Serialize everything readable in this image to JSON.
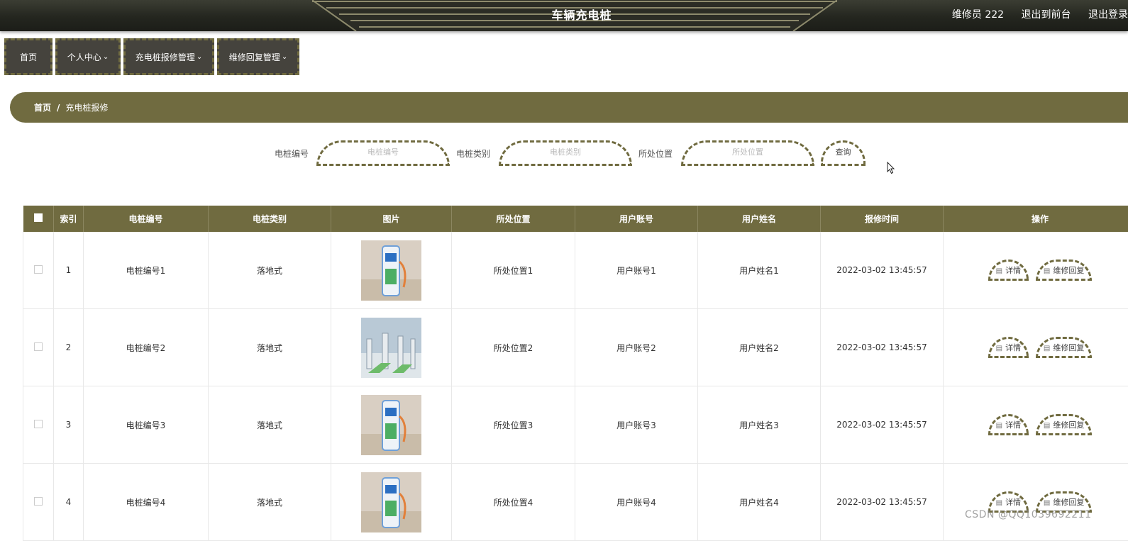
{
  "header": {
    "title": "车辆充电桩",
    "user_label": "维修员 222",
    "to_front_label": "退出到前台",
    "logout_label": "退出登录"
  },
  "nav": {
    "items": [
      {
        "label": "首页"
      },
      {
        "label": "个人中心"
      },
      {
        "label": "充电桩报修管理"
      },
      {
        "label": "维修回复管理"
      }
    ]
  },
  "breadcrumb": {
    "home": "首页",
    "separator": "/",
    "current": "充电桩报修"
  },
  "search": {
    "fields": [
      {
        "label": "电桩编号",
        "placeholder": "电桩编号"
      },
      {
        "label": "电桩类别",
        "placeholder": "电桩类别"
      },
      {
        "label": "所处位置",
        "placeholder": "所处位置"
      }
    ],
    "button_label": "查询"
  },
  "table": {
    "columns": [
      "索引",
      "电桩编号",
      "电桩类别",
      "图片",
      "所处位置",
      "用户账号",
      "用户姓名",
      "报修时间",
      "操作"
    ],
    "rows": [
      {
        "index": "1",
        "code": "电桩编号1",
        "category": "落地式",
        "location": "所处位置1",
        "account": "用户账号1",
        "name": "用户姓名1",
        "time": "2022-03-02 13:45:57"
      },
      {
        "index": "2",
        "code": "电桩编号2",
        "category": "落地式",
        "location": "所处位置2",
        "account": "用户账号2",
        "name": "用户姓名2",
        "time": "2022-03-02 13:45:57"
      },
      {
        "index": "3",
        "code": "电桩编号3",
        "category": "落地式",
        "location": "所处位置3",
        "account": "用户账号3",
        "name": "用户姓名3",
        "time": "2022-03-02 13:45:57"
      },
      {
        "index": "4",
        "code": "电桩编号4",
        "category": "落地式",
        "location": "所处位置4",
        "account": "用户账号4",
        "name": "用户姓名4",
        "time": "2022-03-02 13:45:57"
      }
    ],
    "actions": {
      "detail": "详情",
      "reply": "维修回复"
    }
  },
  "watermark": "CSDN @QQ1039692211",
  "colors": {
    "accent": "#706b40",
    "header_bg": "#24261f",
    "nav_bg": "#45433d"
  }
}
